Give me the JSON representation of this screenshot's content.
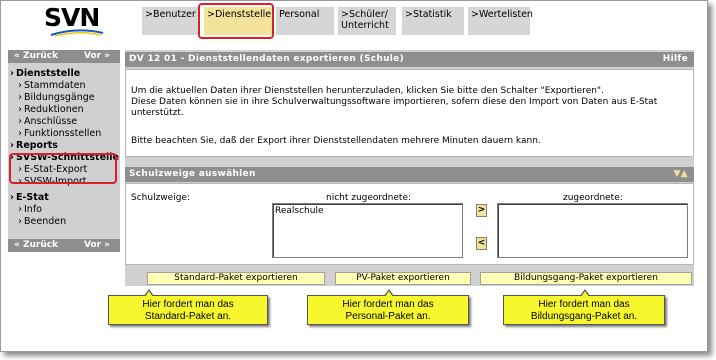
{
  "app": {
    "logo": "SVN"
  },
  "tabs": [
    {
      "label": ">Benutzer"
    },
    {
      "label": ">Dienststelle"
    },
    {
      "label": "Personal"
    },
    {
      "label": ">Schüler/ Unterricht"
    },
    {
      "label": ">Statistik"
    },
    {
      "label": ">Wertelisten"
    }
  ],
  "active_tab": "Dienststelle",
  "nav": {
    "back_label": "« Zurück",
    "fwd_label": "Vor »",
    "items": [
      {
        "label": "Dienststelle",
        "level": 0
      },
      {
        "label": "Stammdaten",
        "level": 1
      },
      {
        "label": "Bildungsgänge",
        "level": 1
      },
      {
        "label": "Reduktionen",
        "level": 1
      },
      {
        "label": "Anschlüsse",
        "level": 1
      },
      {
        "label": "Funktionsstellen",
        "level": 1
      },
      {
        "label": "Reports",
        "level": 0
      },
      {
        "label": "SVSW-Schnittstelle",
        "level": 0
      },
      {
        "label": "E-Stat-Export",
        "level": 1
      },
      {
        "label": "SVSW-Import",
        "level": 1
      },
      {
        "label": "E-Stat",
        "level": 0
      },
      {
        "label": "Info",
        "level": 1
      },
      {
        "label": "Beenden",
        "level": 1
      }
    ]
  },
  "main": {
    "title": "DV 12 01 - Dienststellendaten exportieren (Schule)",
    "help": "Hilfe",
    "para1": "Um die aktuellen Daten ihrer Dienststellen herunterzuladen, klicken Sie bitte den Schalter \"Exportieren\".",
    "para2": "Diese Daten können sie in ihre Schulverwaltungssoftware importieren, sofern diese den Import von Daten aus E-Stat unterstützt.",
    "para3": "Bitte beachten Sie, daß der Export ihrer Dienststellendaten mehrere Minuten dauern kann.",
    "section_title": "Schulzweige auswählen",
    "field_label": "Schulzweige:",
    "left_list_label": "nicht zugeordnete:",
    "right_list_label": "zugeordnete:",
    "left_list_items": [
      "Realschule"
    ],
    "right_list_items": [],
    "move_right": ">",
    "move_left": "<",
    "buttons": [
      {
        "label": "Standard-Paket exportieren"
      },
      {
        "label": "PV-Paket exportieren"
      },
      {
        "label": "Bildungsgang-Paket exportieren"
      }
    ]
  },
  "callouts": [
    {
      "line1": "Hier fordert man das",
      "line2": "Standard-Paket an."
    },
    {
      "line1": "Hier fordert man das",
      "line2": "Personal-Paket an."
    },
    {
      "line1": "Hier fordert man das",
      "line2": "Bildungsgang-Paket an."
    }
  ],
  "colors": {
    "accent_red": "#d8202a",
    "header_gray": "#8e8e8e",
    "panel_gray": "#d0d0d0",
    "tab_active": "#f3e39a",
    "callout_yellow": "#f7f72e",
    "button_yellow": "#fdfdb3"
  }
}
